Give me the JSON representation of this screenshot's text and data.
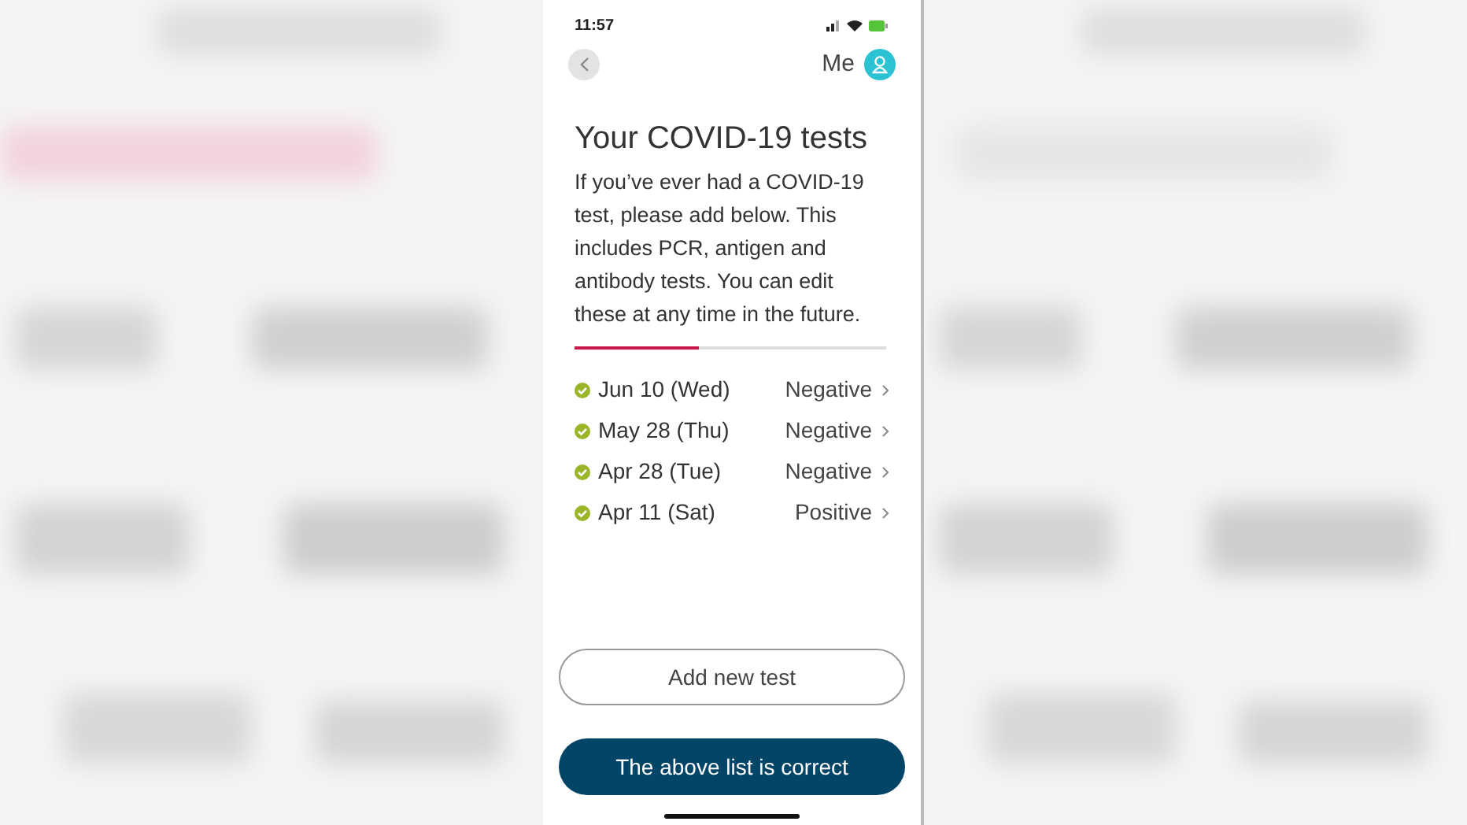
{
  "status_bar": {
    "time": "11:57"
  },
  "header": {
    "profile_label": "Me"
  },
  "title": "Your COVID-19 tests",
  "description": "If you’ve ever had a COVID-19 test, please add below. This includes PCR, antigen and antibody tests. You can edit these at any time in the future.",
  "progress": {
    "level": 0.4
  },
  "tests": [
    {
      "date": "Jun 10 (Wed)",
      "result": "Negative",
      "color": "#9bb529"
    },
    {
      "date": "May 28 (Thu)",
      "result": "Negative",
      "color": "#9bb529"
    },
    {
      "date": "Apr 28 (Tue)",
      "result": "Negative",
      "color": "#9bb529"
    },
    {
      "date": "Apr 11 (Sat)",
      "result": "Positive",
      "color": "#9bb529"
    }
  ],
  "buttons": [
    {
      "label": "Add new test",
      "kind": "outline"
    },
    {
      "label": "The above list is correct",
      "kind": "filled"
    }
  ]
}
